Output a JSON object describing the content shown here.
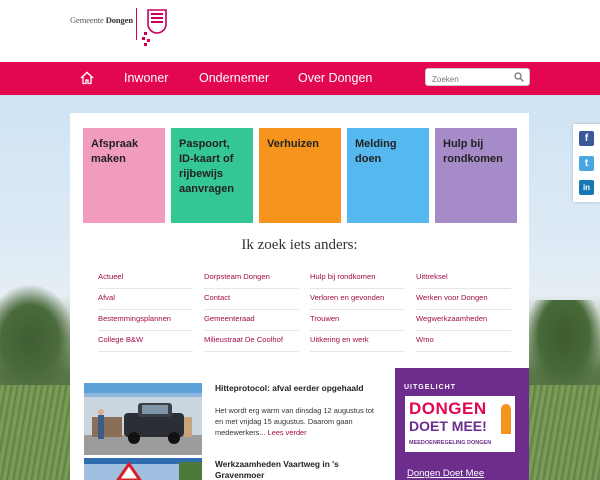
{
  "header": {
    "logo_prefix": "Gemeente",
    "logo_name": "Dongen"
  },
  "nav": {
    "items": [
      {
        "label": "Inwoner"
      },
      {
        "label": "Ondernemer"
      },
      {
        "label": "Over Dongen"
      }
    ],
    "search_placeholder": "Zoeken"
  },
  "tiles": [
    {
      "label": "Afspraak maken",
      "color": "#f19bbf"
    },
    {
      "label": "Paspoort, ID-kaart of rijbewijs aanvragen",
      "color": "#34c693"
    },
    {
      "label": "Verhuizen",
      "color": "#f7941d"
    },
    {
      "label": "Melding doen",
      "color": "#55b8ef"
    },
    {
      "label": "Hulp bij rondkomen",
      "color": "#a58bc7"
    }
  ],
  "search_heading": "Ik zoek iets anders:",
  "links": [
    [
      "Actueel",
      "Afval",
      "Bestemmingsplannen",
      "College B&W"
    ],
    [
      "Dorpsteam Dongen",
      "Contact",
      "Gemeenteraad",
      "Milieustraat De Coolhof"
    ],
    [
      "Hulp bij rondkomen",
      "Verloren en gevonden",
      "Trouwen",
      "Uitkering en werk"
    ],
    [
      "Uittreksel",
      "Werken voor Dongen",
      "Wegwerkzaamheden",
      "Wmo"
    ]
  ],
  "news": [
    {
      "title": "Hitteprotocol: afval eerder opgehaald",
      "body": "Het wordt erg warm van dinsdag 12 augustus tot en met vrijdag 15 augustus. Daarom gaan medewerkers...",
      "more": "Lees verder"
    },
    {
      "title": "Werkzaamheden Vaartweg in 's Gravenmoer"
    }
  ],
  "uitgelicht": {
    "label": "UITGELICHT",
    "card_line1": "DONGEN",
    "card_line2": "DOET MEE!",
    "card_line3": "MEEDOENREGELING DONGEN",
    "link": "Dongen Doet Mee"
  },
  "social": {
    "facebook": "f",
    "twitter": "t",
    "linkedin": "in"
  },
  "colors": {
    "brand": "#e2074f",
    "link": "#a10d4a",
    "uitgelicht_bg": "#6c2d8c"
  }
}
